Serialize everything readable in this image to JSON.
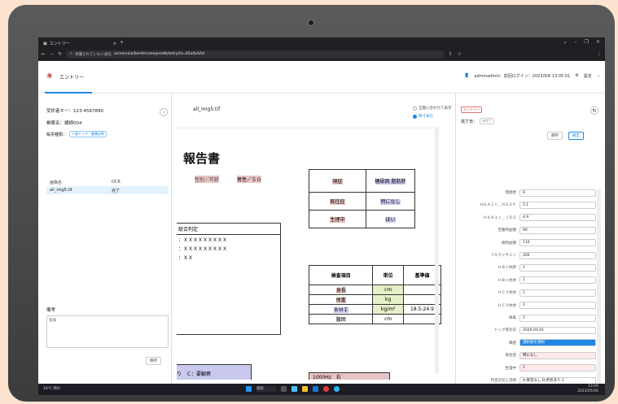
{
  "browser": {
    "tab_title": "エントリー",
    "url_warning": "保護されていない通信",
    "url": "ocrservice/bordercomeprrelb/entry/id=02x0xAAA"
  },
  "header": {
    "title": "エントリー",
    "user": "adminadmin：前回ログイン：2023/5/6 13:05:01",
    "settings": "設定"
  },
  "left": {
    "receipt_no": "受診者キー：123-4567890",
    "group": "帳票名：講師004",
    "doc_type_label": "帳票種類：",
    "doc_type_tag": "人間ドック・健康診断",
    "col_file": "画像名",
    "col_ocr": "OCR",
    "file_name": "all_img5.tif",
    "ocr_status": "完了",
    "memo_label": "備考",
    "memo_placeholder": "追加",
    "save": "保存"
  },
  "middle": {
    "file_name": "all_img5.tif",
    "radio1": "全面に合わせて表示",
    "radio2": "原寸表示",
    "doc": {
      "title": "報告書",
      "age_label": "性別／年齢",
      "age_value": "男性／５０",
      "overall": "総合判定",
      "x_line1": "：ＸＸＸＸＸＸＸＸＸ",
      "x_line2": "：ＸＸＸＸＸＸＸＸＸ",
      "x_line3": "：ＸＸ",
      "t1": [
        {
          "k": "現症",
          "v": "糖尿病 脂肪肝"
        },
        {
          "k": "既往症",
          "v": "特になし"
        },
        {
          "k": "生理中",
          "v": "はい"
        }
      ],
      "headers": [
        "検査項目",
        "単位",
        "基準値"
      ],
      "items": [
        {
          "n": "身長",
          "u": "cm",
          "r": ""
        },
        {
          "n": "体重",
          "u": "kg",
          "r": ""
        },
        {
          "n": "ＢＭＩ",
          "u": "kg/m²",
          "r": "18.5-24.9"
        },
        {
          "n": "腹囲",
          "u": "cm",
          "r": ""
        }
      ],
      "bottom_left": "り　Ｃ：要観察",
      "bottom_right": "1000Hz　右"
    }
  },
  "right": {
    "status_tag": "エントリー",
    "done_label": "完了日：",
    "done_tag": "未完了",
    "save": "保存",
    "confirm": "確定",
    "fields": [
      {
        "l": "喫煙歴",
        "v": "6"
      },
      {
        "l": "ＨｂＡ１ｃ＿ＮＧＳＰ",
        "v": "5.1"
      },
      {
        "l": "ＨｂＡ１ｃ＿ＪＤＳ",
        "v": "4.9"
      },
      {
        "l": "空腹時血糖",
        "v": "90"
      },
      {
        "l": "随時血糖",
        "v": "110"
      },
      {
        "l": "フルクトサミン",
        "v": "200"
      },
      {
        "l": "ＨＢｓ抗原",
        "v": "1"
      },
      {
        "l": "ＨＢｓ抗体",
        "v": "1"
      },
      {
        "l": "ＨＣＶ抗体",
        "v": "1"
      },
      {
        "l": "ＨＣＶ抗体",
        "v": "1"
      },
      {
        "l": "梅毒",
        "v": "1"
      },
      {
        "l": "ドック受診日",
        "v": "2020-05-01"
      },
      {
        "l": "職歴",
        "v": "選択肢を選択"
      },
      {
        "l": "既往症",
        "v": "特になし"
      },
      {
        "l": "生理中",
        "v": "1"
      },
      {
        "l": "判定記号と説明",
        "v": "A:異常なし B:所見あり C"
      }
    ]
  },
  "taskbar": {
    "weather": "19°C 晴れ",
    "search": "検索",
    "time": "13:09",
    "date": "2023/05/06"
  }
}
